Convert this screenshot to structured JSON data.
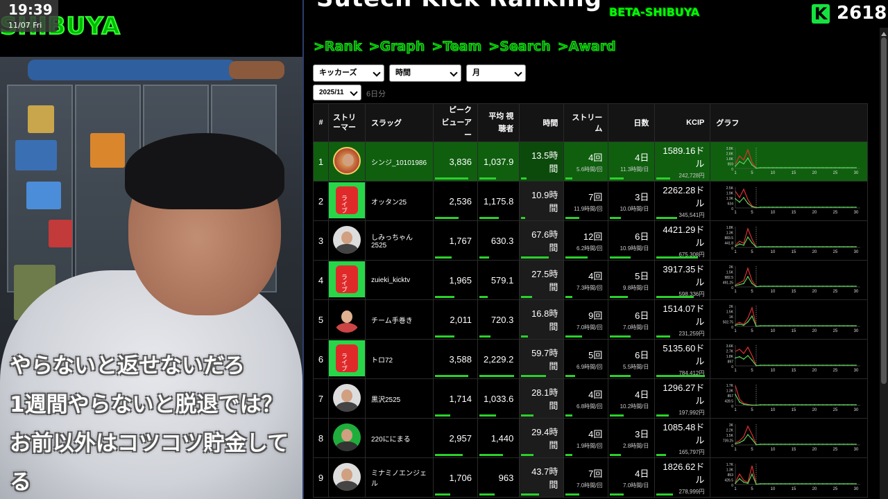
{
  "overlay": {
    "clock_time": "19:39",
    "clock_date": "11/07 Fri",
    "logo_text": "SHIBUYA",
    "subtitle_lines": [
      "やらないと返せないだろ",
      "1週間やらないと脱退では？",
      "お前以外はコツコツ貯金して",
      "る"
    ]
  },
  "header": {
    "title": "Sutech Kick Ranking",
    "beta_label": "BETA-SHIBUYA",
    "k_badge": "K",
    "k_count": "2618"
  },
  "nav": [
    "Rank",
    "Graph",
    "Team",
    "Search",
    "Award"
  ],
  "filters": {
    "platform": "キッカーズ",
    "metric": "時間",
    "period": "月",
    "month": "2025/11",
    "days_label": "6日分"
  },
  "table": {
    "headers": {
      "rank": "#",
      "streamer": "ストリーマー",
      "slug": "スラッグ",
      "peak": "ピーク ビューアー",
      "avg": "平均 視聴者",
      "hours": "時間",
      "streams": "ストリーム",
      "days": "日数",
      "kcip": "KCIP",
      "graph": "グラフ"
    },
    "rows": [
      {
        "rank": "1",
        "slug": "シンジ_10101986",
        "peak": "3,836",
        "avg": "1,037.9",
        "hours": "13.5時間",
        "streams": "4回",
        "streams_sub": "5.6時間/回",
        "days": "4日",
        "days_sub": "11.3時間/日",
        "kcip": "1589.16ドル",
        "kcip_yen": "242,728円",
        "avatar": "cartoon",
        "yticks": [
          "3.8K",
          "2.8K",
          "1.8K",
          "959",
          "0"
        ]
      },
      {
        "rank": "2",
        "slug": "オッタン25",
        "peak": "2,536",
        "avg": "1,175.8",
        "hours": "10.9時間",
        "streams": "7回",
        "streams_sub": "11.9時間/回",
        "days": "3日",
        "days_sub": "10.0時間/日",
        "kcip": "2262.28ドル",
        "kcip_yen": "345,541円",
        "avatar": "live",
        "yticks": [
          "2.5K",
          "1.9K",
          "1.3K",
          "634",
          "0"
        ]
      },
      {
        "rank": "3",
        "slug": "しみっちゃん2525",
        "peak": "1,767",
        "avg": "630.3",
        "hours": "67.6時間",
        "streams": "12回",
        "streams_sub": "6.2時間/回",
        "days": "6日",
        "days_sub": "10.9時間/日",
        "kcip": "4421.29ドル",
        "kcip_yen": "675,308円",
        "avatar": "photo",
        "yticks": [
          "1.8K",
          "1.3K",
          "883.5",
          "441.8",
          "0"
        ]
      },
      {
        "rank": "4",
        "slug": "zuieki_kicktv",
        "peak": "1,965",
        "avg": "579.1",
        "hours": "27.5時間",
        "streams": "4回",
        "streams_sub": "7.3時間/回",
        "days": "5日",
        "days_sub": "9.8時間/日",
        "kcip": "3917.35ドル",
        "kcip_yen": "598,336円",
        "avatar": "live",
        "yticks": [
          "2K",
          "1.5K",
          "982.5",
          "491.25",
          "0"
        ]
      },
      {
        "rank": "5",
        "slug": "チーム手巻き",
        "peak": "2,011",
        "avg": "720.3",
        "hours": "16.8時間",
        "streams": "9回",
        "streams_sub": "7.0時間/回",
        "days": "6日",
        "days_sub": "7.0時間/日",
        "kcip": "1514.07ドル",
        "kcip_yen": "231,259円",
        "avatar": "cartoon2",
        "yticks": [
          "2K",
          "1.5K",
          "1K",
          "502.75",
          "0"
        ]
      },
      {
        "rank": "6",
        "slug": "トロ72",
        "peak": "3,588",
        "avg": "2,229.2",
        "hours": "59.7時間",
        "streams": "5回",
        "streams_sub": "6.9時間/回",
        "days": "6日",
        "days_sub": "5.5時間/日",
        "kcip": "5135.60ドル",
        "kcip_yen": "784,412円",
        "avatar": "live",
        "yticks": [
          "3.6K",
          "2.7K",
          "1.8K",
          "897",
          "0"
        ]
      },
      {
        "rank": "7",
        "slug": "黒沢2525",
        "peak": "1,714",
        "avg": "1,033.6",
        "hours": "28.1時間",
        "streams": "4回",
        "streams_sub": "6.8時間/回",
        "days": "4日",
        "days_sub": "10.2時間/日",
        "kcip": "1296.27ドル",
        "kcip_yen": "197,992円",
        "avatar": "photo",
        "yticks": [
          "1.7K",
          "1.3K",
          "857",
          "428.5",
          "0"
        ]
      },
      {
        "rank": "8",
        "slug": "220ににまる",
        "peak": "2,957",
        "avg": "1,440",
        "hours": "29.4時間",
        "streams": "4回",
        "streams_sub": "1.9時間/回",
        "days": "3日",
        "days_sub": "2.8時間/日",
        "kcip": "1085.48ドル",
        "kcip_yen": "165,797円",
        "avatar": "green",
        "yticks": [
          "3K",
          "2.2K",
          "1.5K",
          "739.25",
          "0"
        ]
      },
      {
        "rank": "9",
        "slug": "ミナミノエンジェル",
        "peak": "1,706",
        "avg": "963",
        "hours": "43.7時間",
        "streams": "7回",
        "streams_sub": "7.0時間/回",
        "days": "4日",
        "days_sub": "7.0時間/日",
        "kcip": "1826.62ドル",
        "kcip_yen": "278,999円",
        "avatar": "photo",
        "yticks": [
          "1.7K",
          "1.3K",
          "853",
          "426.5",
          "0"
        ]
      }
    ],
    "graph_xticks": [
      "1",
      "5",
      "10",
      "15",
      "20",
      "25",
      "30"
    ],
    "live_label": "ライブ"
  },
  "colors": {
    "accent_green": "#2ad12a",
    "first_row": "#0f5f0f",
    "spark_red": "#e03030",
    "spark_green": "#5ad05a"
  }
}
